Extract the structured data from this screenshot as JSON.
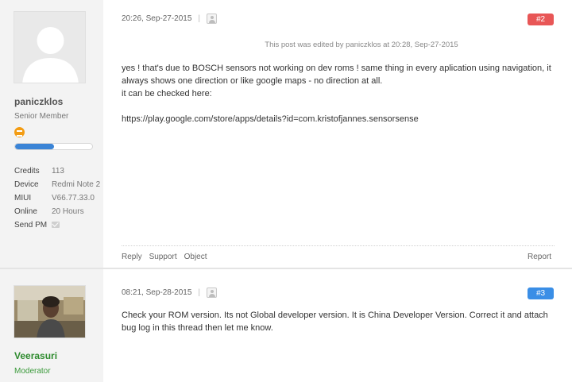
{
  "colors": {
    "floor2": "#e85656",
    "floor3": "#3a8ee6",
    "moderator_name": "#2e8b2e",
    "progress": "#3b84d6"
  },
  "post1": {
    "username": "paniczklos",
    "role": "Senior Member",
    "avatar": "default-avatar-silhouette",
    "level_progress_fraction": 0.5,
    "stats": [
      {
        "key": "Credits",
        "value": "113"
      },
      {
        "key": "Device",
        "value": "Redmi Note 2"
      },
      {
        "key": "MIUI",
        "value": "V66.77.33.0"
      },
      {
        "key": "Online",
        "value": "20 Hours"
      },
      {
        "key": "Send PM",
        "icon": "mail-icon"
      }
    ],
    "timestamp": "20:26, Sep-27-2015",
    "separator": "|",
    "floor": "#2",
    "edited_note": "This post was edited by paniczklos at 20:28, Sep-27-2015",
    "body": [
      "yes ! that's due to BOSCH sensors not working on dev roms ! same thing in every aplication using navigation, it always shows one direction or like google maps - no direction at all.",
      "it can be checked here:",
      "",
      "https://play.google.com/store/apps/details?id=com.kristofjannes.sensorsense"
    ],
    "actions": [
      "Reply",
      "Support",
      "Object"
    ],
    "report": "Report"
  },
  "post2": {
    "username": "Veerasuri",
    "role": "Moderator",
    "avatar": "user-photo",
    "timestamp": "08:21, Sep-28-2015",
    "separator": "|",
    "floor": "#3",
    "body": "Check your ROM version. Its not Global developer version. It is China Developer Version. Correct it and attach bug log in this thread then let me know."
  }
}
